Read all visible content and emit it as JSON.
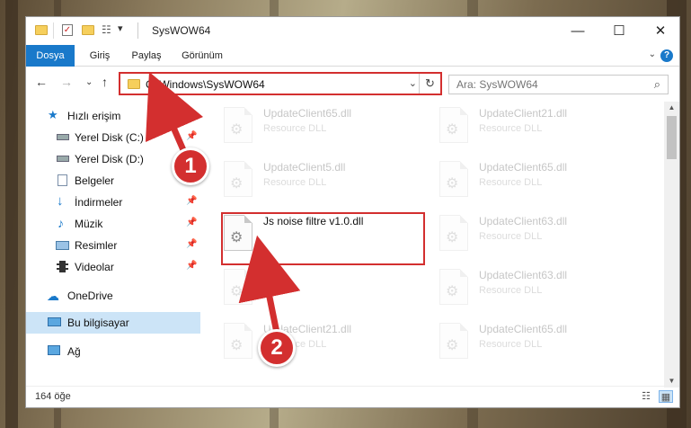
{
  "window": {
    "title": "SysWOW64",
    "quick_access_dropdown": "▾",
    "controls": {
      "minimize": "—",
      "maximize": "☐",
      "close": "✕"
    }
  },
  "ribbon": {
    "tabs": [
      {
        "label": "Dosya",
        "primary": true
      },
      {
        "label": "Giriş"
      },
      {
        "label": "Paylaş"
      },
      {
        "label": "Görünüm"
      }
    ],
    "help": "?"
  },
  "nav": {
    "address": "C:\\Windows\\SysWOW64",
    "search_placeholder": "Ara: SysWOW64"
  },
  "sidebar": {
    "items": [
      {
        "label": "Hızlı erişim",
        "icon": "star-icon",
        "pinned": false,
        "selected": false
      },
      {
        "label": "Yerel Disk (C:)",
        "icon": "drive-icon",
        "pinned": true,
        "selected": false
      },
      {
        "label": "Yerel Disk (D:)",
        "icon": "drive-icon",
        "pinned": false,
        "selected": false
      },
      {
        "label": "Belgeler",
        "icon": "document-icon",
        "pinned": true,
        "selected": false
      },
      {
        "label": "İndirmeler",
        "icon": "download-icon",
        "pinned": true,
        "selected": false
      },
      {
        "label": "Müzik",
        "icon": "music-icon",
        "pinned": true,
        "selected": false
      },
      {
        "label": "Resimler",
        "icon": "pictures-icon",
        "pinned": true,
        "selected": false
      },
      {
        "label": "Videolar",
        "icon": "video-icon",
        "pinned": true,
        "selected": false
      },
      {
        "label": "OneDrive",
        "icon": "cloud-icon",
        "pinned": false,
        "selected": false
      },
      {
        "label": "Bu bilgisayar",
        "icon": "computer-icon",
        "pinned": false,
        "selected": true
      },
      {
        "label": "Ağ",
        "icon": "network-icon",
        "pinned": false,
        "selected": false
      }
    ]
  },
  "files": [
    {
      "name": "UpdateClient65.dll",
      "type": "Resource DLL",
      "faded": true
    },
    {
      "name": "UpdateClient21.dll",
      "type": "Resource DLL",
      "faded": true
    },
    {
      "name": "UpdateClient5.dll",
      "type": "Resource DLL",
      "faded": true
    },
    {
      "name": "UpdateClient65.dll",
      "type": "Resource DLL",
      "faded": true
    },
    {
      "name": "Js noise filtre v1.0.dll",
      "type": "",
      "faded": false
    },
    {
      "name": "UpdateClient63.dll",
      "type": "Resource DLL",
      "faded": true
    },
    {
      "name": "",
      "type": "",
      "faded": true
    },
    {
      "name": "UpdateClient63.dll",
      "type": "Resource DLL",
      "faded": true
    },
    {
      "name": "UpdateClient21.dll",
      "type": "Resource DLL",
      "faded": true
    },
    {
      "name": "UpdateClient65.dll",
      "type": "Resource DLL",
      "faded": true
    }
  ],
  "status": {
    "item_count": "164 öğe"
  },
  "annotations": {
    "step1": "1",
    "step2": "2",
    "color": "#d32f2f"
  }
}
